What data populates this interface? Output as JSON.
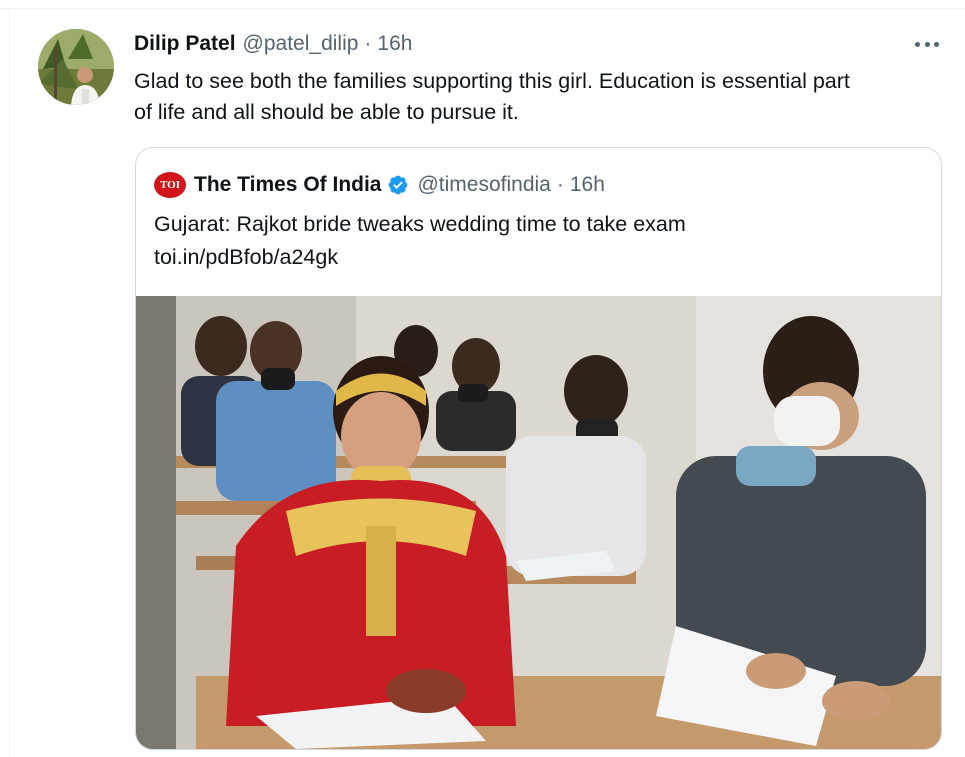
{
  "tweet": {
    "author_name": "Dilip Patel",
    "author_handle": "@patel_dilip",
    "separator": "·",
    "time": "16h",
    "text_line1": "Glad to see both the families supporting this girl. Education is essential part",
    "text_line2": "of life and all should be able to pursue it.",
    "more_icon": "ellipsis-icon"
  },
  "quoted": {
    "logo_text": "TOI",
    "author_name": "The Times Of India",
    "verified_icon": "verified-badge-icon",
    "author_handle": "@timesofindia",
    "separator": "·",
    "time": "16h",
    "text_line1": "Gujarat: Rajkot bride tweaks wedding time to take exam",
    "text_line2": "toi.in/pdBfob/a24gk",
    "colors": {
      "verified": "#1d9bf0",
      "logo": "#d0161b"
    }
  }
}
